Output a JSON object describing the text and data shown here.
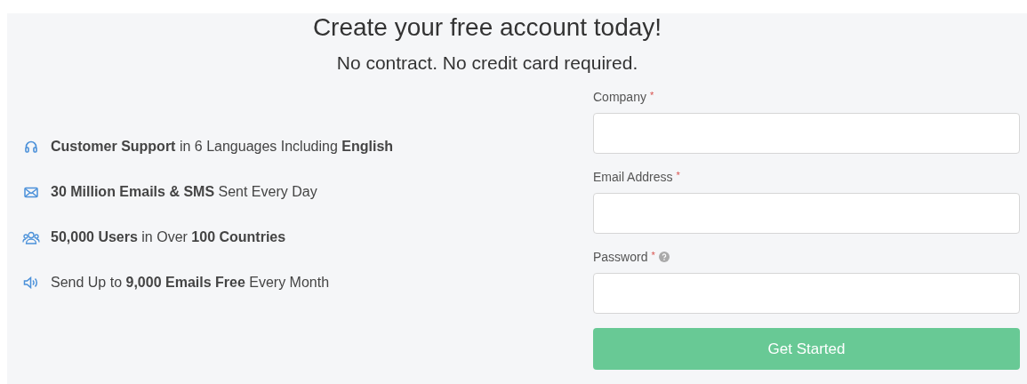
{
  "heading": "Create your free account today!",
  "subheading": "No contract. No credit card required.",
  "features": [
    {
      "kind": "headset",
      "text": "**Customer Support** in 6 Languages Including **English**"
    },
    {
      "kind": "envelope",
      "text": "**30 Million Emails & SMS** Sent Every Day"
    },
    {
      "kind": "users",
      "text": "**50,000 Users** in Over **100 Countries**"
    },
    {
      "kind": "speaker",
      "text": "Send Up to **9,000 Emails Free** Every Month"
    }
  ],
  "form": {
    "fields": [
      {
        "label": "Company",
        "marker": "*",
        "help": false
      },
      {
        "label": "Email Address",
        "marker": "*",
        "help": false
      },
      {
        "label": "Password",
        "marker": "*",
        "help": true
      }
    ],
    "button": "Get Started"
  }
}
